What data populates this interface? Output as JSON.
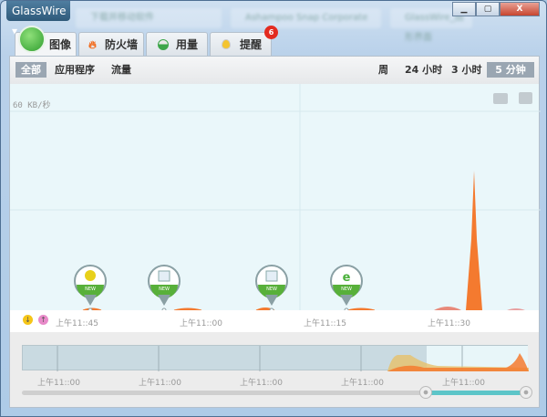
{
  "app": {
    "brand": "GlassWire ▾"
  },
  "background_tabs": [
    "下载并移动软件",
    "Ashampoo Snap Corporate",
    "GlassWire_图形界面"
  ],
  "window_controls": {
    "minimize": "▁",
    "maximize": "▢",
    "close": "X"
  },
  "tabs": [
    {
      "label": "图像",
      "active": true
    },
    {
      "label": "防火墙"
    },
    {
      "label": "用量"
    },
    {
      "label": "提醒",
      "badge": "6"
    }
  ],
  "filters": {
    "all": "全部",
    "apps": "应用程序",
    "traffic": "流量"
  },
  "ranges": {
    "week": "周",
    "h24": "24 小时",
    "h3": "3 小时",
    "m5": "5 分钟",
    "selected": "5 分钟"
  },
  "graph": {
    "scale_label": "60 KB/秒",
    "download_color": "#f5c518",
    "upload_color": "#e88ac9",
    "traffic_color": "#f47a2f"
  },
  "markers": [
    {
      "icon": "360-app-icon",
      "label": "NEW"
    },
    {
      "icon": "window-app-icon",
      "label": "NEW"
    },
    {
      "icon": "window-app-icon",
      "label": "NEW"
    },
    {
      "icon": "ie-app-icon",
      "label": "NEW"
    }
  ],
  "axis_ticks": [
    "上午11::45",
    "上午11::00",
    "上午11::15",
    "上午11::30"
  ],
  "legend": {
    "download": "↓",
    "upload": "↑"
  },
  "overview_ticks": [
    "上午11::00",
    "上午11::00",
    "上午11::00",
    "上午11::00",
    "上午11::00"
  ]
}
